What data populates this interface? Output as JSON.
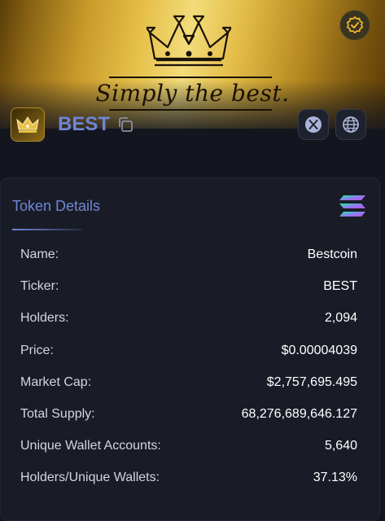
{
  "banner": {
    "tagline": "Simply the best.",
    "background_colors": [
      "#5a3d08",
      "#e6c04a",
      "#f2dc7a",
      "#5b3c06"
    ]
  },
  "token": {
    "symbol": "BEST"
  },
  "icons": {
    "verified": "verified-badge-icon",
    "copy": "copy-icon",
    "x": "x-logo-icon",
    "website": "globe-icon",
    "chain": "solana-icon",
    "logo": "crown-logo-icon"
  },
  "details": {
    "title": "Token Details",
    "rows": [
      {
        "label": "Name:",
        "value": "Bestcoin"
      },
      {
        "label": "Ticker:",
        "value": "BEST"
      },
      {
        "label": "Holders:",
        "value": "2,094"
      },
      {
        "label": "Price:",
        "value": "$0.00004039"
      },
      {
        "label": "Market Cap:",
        "value": "$2,757,695.495"
      },
      {
        "label": "Total Supply:",
        "value": "68,276,689,646.127"
      },
      {
        "label": "Unique Wallet Accounts:",
        "value": "5,640"
      },
      {
        "label": "Holders/Unique Wallets:",
        "value": "37.13%"
      }
    ]
  },
  "colors": {
    "accent": "#6f86d6",
    "background": "#14161f",
    "card": "#191c27"
  }
}
